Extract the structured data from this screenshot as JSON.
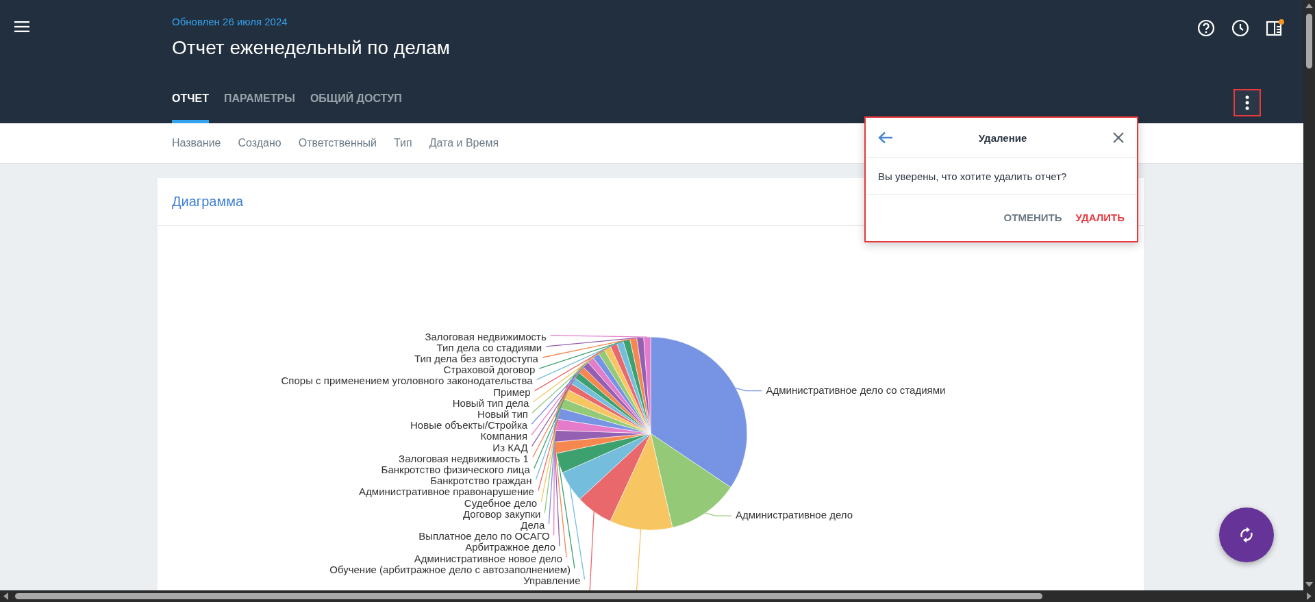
{
  "header": {
    "updated": "Обновлен 26 июля 2024",
    "title": "Отчет еженедельный по делам",
    "has_notification": true,
    "tabs": [
      {
        "label": "ОТЧЕТ",
        "selected": true
      },
      {
        "label": "ПАРАМЕТРЫ",
        "selected": false
      },
      {
        "label": "ОБЩИЙ ДОСТУП",
        "selected": false
      }
    ],
    "menu_button": {
      "highlighted": true
    }
  },
  "columns": [
    "Название",
    "Создано",
    "Ответственный",
    "Тип",
    "Дата и Время"
  ],
  "card": {
    "title": "Диаграмма",
    "chart": {
      "slices": [
        {
          "label": "Залоговая недвижимость"
        },
        {
          "label": "Тип дела со стадиями"
        },
        {
          "label": "Тип дела без автодоступа"
        },
        {
          "label": "Страховой договор"
        },
        {
          "label": "Споры с применением уголовного законодательства"
        },
        {
          "label": "Пример"
        },
        {
          "label": "Новый тип дела"
        },
        {
          "label": "Новый тип"
        },
        {
          "label": "Новые объекты/Стройка"
        },
        {
          "label": "Компания"
        },
        {
          "label": "Из КАД"
        },
        {
          "label": "Залоговая недвижимость 1"
        },
        {
          "label": "Банкротство физического лица"
        },
        {
          "label": "Банкротство граждан"
        },
        {
          "label": "Административное правонарушение"
        },
        {
          "label": "Судебное дело"
        },
        {
          "label": "Договор закупки"
        },
        {
          "label": "Дела"
        },
        {
          "label": "Выплатное дело по ОСАГО"
        },
        {
          "label": "Арбитражное дело"
        },
        {
          "label": "Административное новое дело"
        },
        {
          "label": "Обучение (арбитражное дело с автозаполнением)"
        },
        {
          "label": "Управление"
        },
        {
          "label": "Административное дело"
        },
        {
          "label": "Административное дело со стадиями"
        }
      ]
    }
  },
  "dialog": {
    "title": "Удаление",
    "message": "Вы уверены, что хотите удалить отчет?",
    "highlighted": true,
    "actions": [
      {
        "label": "ОТМЕНИТЬ",
        "kind": "cancel"
      },
      {
        "label": "УДАЛИТЬ",
        "kind": "danger"
      }
    ]
  }
}
